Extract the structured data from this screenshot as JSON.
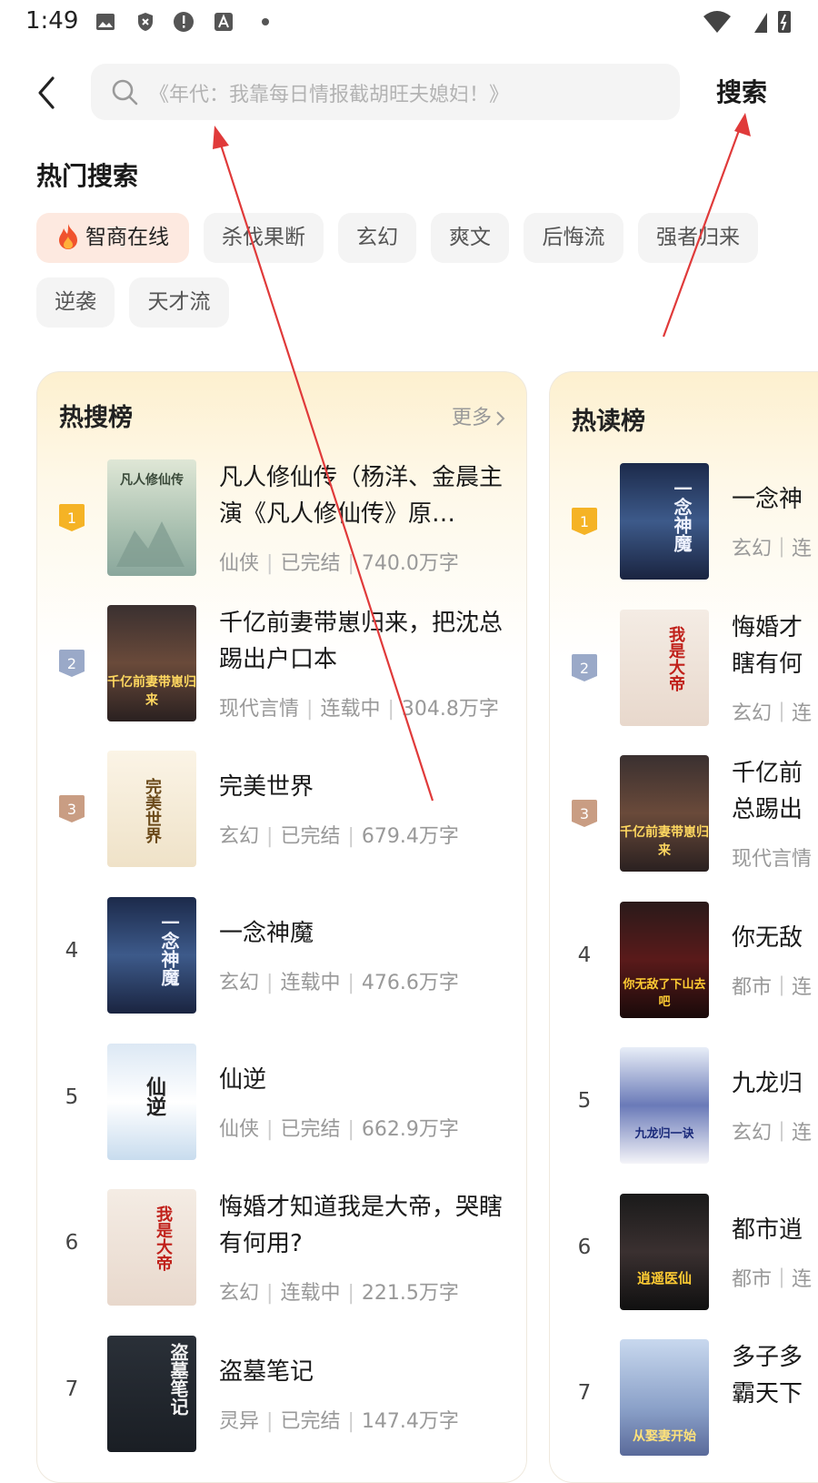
{
  "status_bar": {
    "time": "1:49"
  },
  "search": {
    "placeholder": "《年代：我靠每日情报截胡旺夫媳妇！》",
    "button_label": "搜索"
  },
  "hot_search": {
    "title": "热门搜索",
    "tags": [
      "智商在线",
      "杀伐果断",
      "玄幻",
      "爽文",
      "后悔流",
      "强者归来",
      "逆袭",
      "天才流"
    ]
  },
  "hot_search_rank": {
    "title": "热搜榜",
    "more_label": "更多",
    "items": [
      {
        "rank": "1",
        "title": "凡人修仙传（杨洋、金晨主演《凡人修仙传》原…",
        "genre": "仙侠",
        "status": "已完结",
        "words": "740.0万字",
        "cover_text": "凡人修仙传"
      },
      {
        "rank": "2",
        "title": "千亿前妻带崽归来，把沈总踢出户口本",
        "genre": "现代言情",
        "status": "连载中",
        "words": "304.8万字",
        "cover_text": "千亿前妻带崽归来"
      },
      {
        "rank": "3",
        "title": "完美世界",
        "genre": "玄幻",
        "status": "已完结",
        "words": "679.4万字",
        "cover_text": "完美世界"
      },
      {
        "rank": "4",
        "title": "一念神魔",
        "genre": "玄幻",
        "status": "连载中",
        "words": "476.6万字",
        "cover_text": "一念神魔"
      },
      {
        "rank": "5",
        "title": "仙逆",
        "genre": "仙侠",
        "status": "已完结",
        "words": "662.9万字",
        "cover_text": "仙逆"
      },
      {
        "rank": "6",
        "title": "悔婚才知道我是大帝，哭瞎有何用?",
        "genre": "玄幻",
        "status": "连载中",
        "words": "221.5万字",
        "cover_text": "我是大帝"
      },
      {
        "rank": "7",
        "title": "盗墓笔记",
        "genre": "灵异",
        "status": "已完结",
        "words": "147.4万字",
        "cover_text": "盗墓笔记"
      }
    ]
  },
  "hot_read_rank": {
    "title": "热读榜",
    "items": [
      {
        "rank": "1",
        "title": "一念神",
        "meta": "玄幻｜连",
        "cover_text": "一念神魔"
      },
      {
        "rank": "2",
        "title": "悔婚才\n瞎有何",
        "meta": "玄幻｜连",
        "cover_text": "我是大帝"
      },
      {
        "rank": "3",
        "title": "千亿前\n总踢出",
        "meta": "现代言情",
        "cover_text": "千亿前妻带崽归来"
      },
      {
        "rank": "4",
        "title": "你无敌",
        "meta": "都市｜连",
        "cover_text": "你无敌了下山去吧"
      },
      {
        "rank": "5",
        "title": "九龙归",
        "meta": "玄幻｜连",
        "cover_text": "九龙归一诀"
      },
      {
        "rank": "6",
        "title": "都市逍",
        "meta": "都市｜连",
        "cover_text": "逍遥医仙"
      },
      {
        "rank": "7",
        "title": "多子多\n霸天下",
        "meta": "",
        "cover_text": "从娶妻开始"
      }
    ]
  },
  "colors": {
    "rank1": "#f5b325",
    "rank2": "#9aa9c8",
    "rank3": "#c99d83",
    "annotation_arrow": "#e03a3a"
  }
}
